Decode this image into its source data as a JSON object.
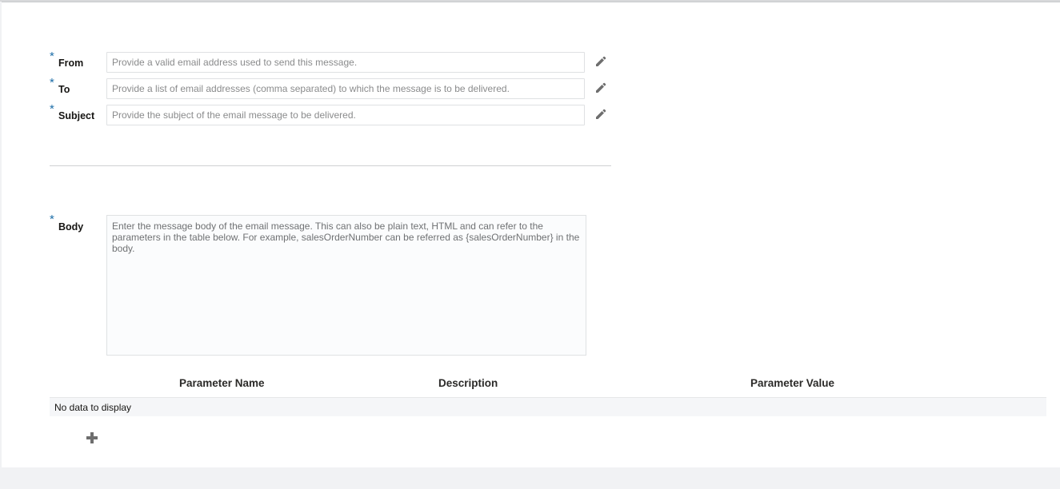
{
  "form": {
    "required_marker": "*",
    "from": {
      "label": "From",
      "value": "",
      "placeholder": "Provide a valid email address used to send this message."
    },
    "to": {
      "label": "To",
      "value": "",
      "placeholder": "Provide a list of email addresses (comma separated) to which the message is to be delivered."
    },
    "subject": {
      "label": "Subject",
      "value": "",
      "placeholder": "Provide the subject of the email message to be delivered."
    },
    "body": {
      "label": "Body",
      "value": "",
      "placeholder": "Enter the message body of the email message. This can also be plain text, HTML and can refer to the parameters in the table below. For example, salesOrderNumber can be referred as {salesOrderNumber} in the body."
    }
  },
  "parameters_table": {
    "columns": [
      "Parameter Name",
      "Description",
      "Parameter Value"
    ],
    "rows": [],
    "empty_text": "No data to display"
  },
  "icons": {
    "edit": "pencil-icon",
    "add": "plus-icon"
  },
  "colors": {
    "required_marker": "#1d6ea8",
    "icon": "#6e6e6e"
  }
}
